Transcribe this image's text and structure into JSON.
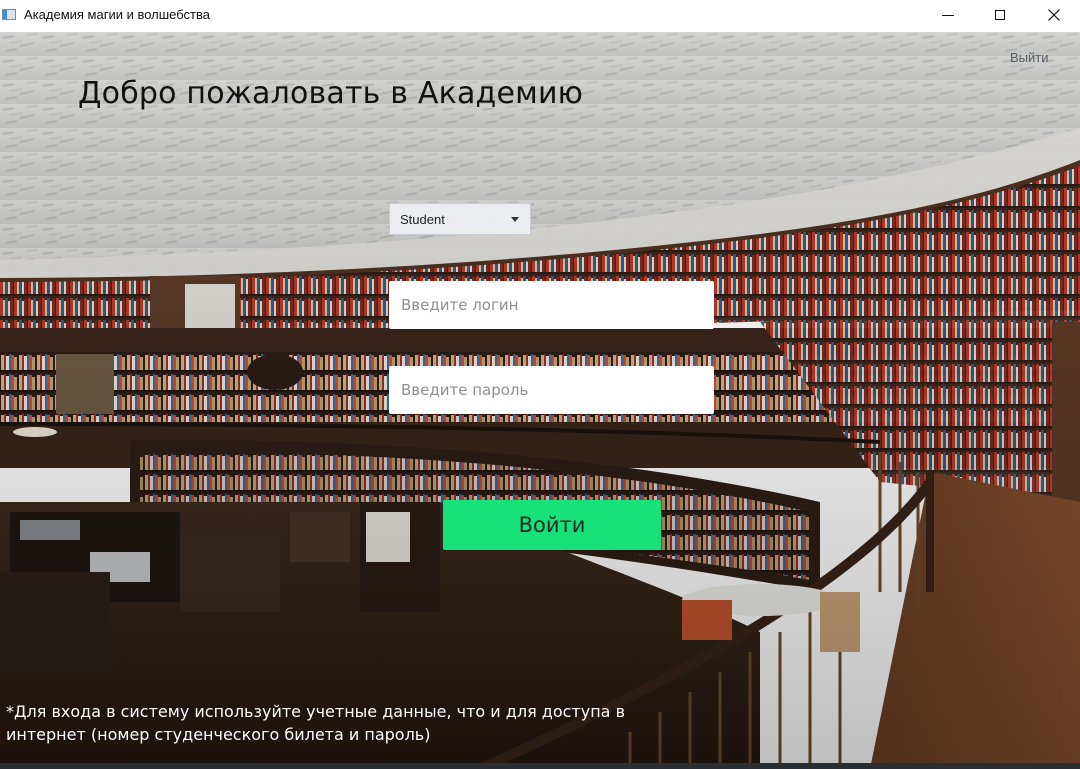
{
  "window": {
    "title": "Академия магии и волшебства",
    "icon": "app-window-icon",
    "controls": {
      "minimize_icon": "minimize-icon",
      "maximize_icon": "maximize-icon",
      "close_icon": "close-icon"
    }
  },
  "header": {
    "welcome": "Добро пожаловать в Академию",
    "logout_label": "Выйти"
  },
  "form": {
    "role": {
      "selected": "Student"
    },
    "login": {
      "placeholder": "Введите логин",
      "value": ""
    },
    "password": {
      "placeholder": "Введите пароль",
      "value": ""
    },
    "submit_label": "Войти"
  },
  "footer": {
    "hint_line1": "*Для входа в систему используйте учетные данные, что и для доступа в",
    "hint_line2": "интернет (номер студенческого билета и пароль)"
  },
  "colors": {
    "submit_button": "#18e07a",
    "field_background": "#ffffff",
    "hint_text": "#ffffff"
  },
  "background": {
    "scene": "library-background-photo"
  }
}
